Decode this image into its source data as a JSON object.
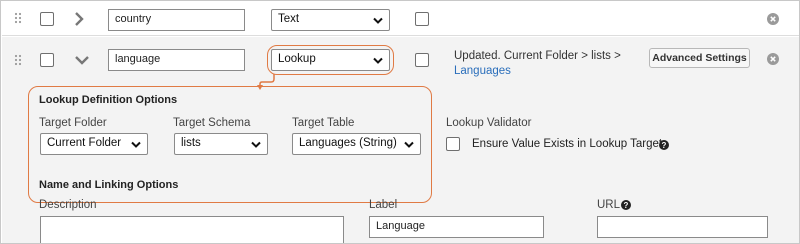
{
  "rows": [
    {
      "name": "country",
      "type": "Text"
    },
    {
      "name": "language",
      "type": "Lookup",
      "status_line1": "Updated. Current Folder > lists >",
      "status_link": "Languages",
      "advanced_button": "Advanced Settings"
    }
  ],
  "lookup": {
    "heading": "Lookup Definition Options",
    "target_folder_label": "Target Folder",
    "target_folder_value": "Current Folder",
    "target_schema_label": "Target Schema",
    "target_schema_value": "lists",
    "target_table_label": "Target Table",
    "target_table_value": "Languages (String)",
    "validator_label": "Lookup Validator",
    "validator_checkbox_label": "Ensure Value Exists in Lookup Target"
  },
  "naming": {
    "heading": "Name and Linking Options",
    "description_label": "Description",
    "label_label": "Label",
    "label_value": "Language",
    "url_label": "URL"
  },
  "colors": {
    "highlight": "#e07a44",
    "link": "#2a6ebb",
    "selected_row_bg": "#f3f3f3"
  },
  "icons": [
    "drag-handle-icon",
    "chevron-right-icon",
    "chevron-down-icon",
    "remove-icon",
    "help-icon"
  ]
}
